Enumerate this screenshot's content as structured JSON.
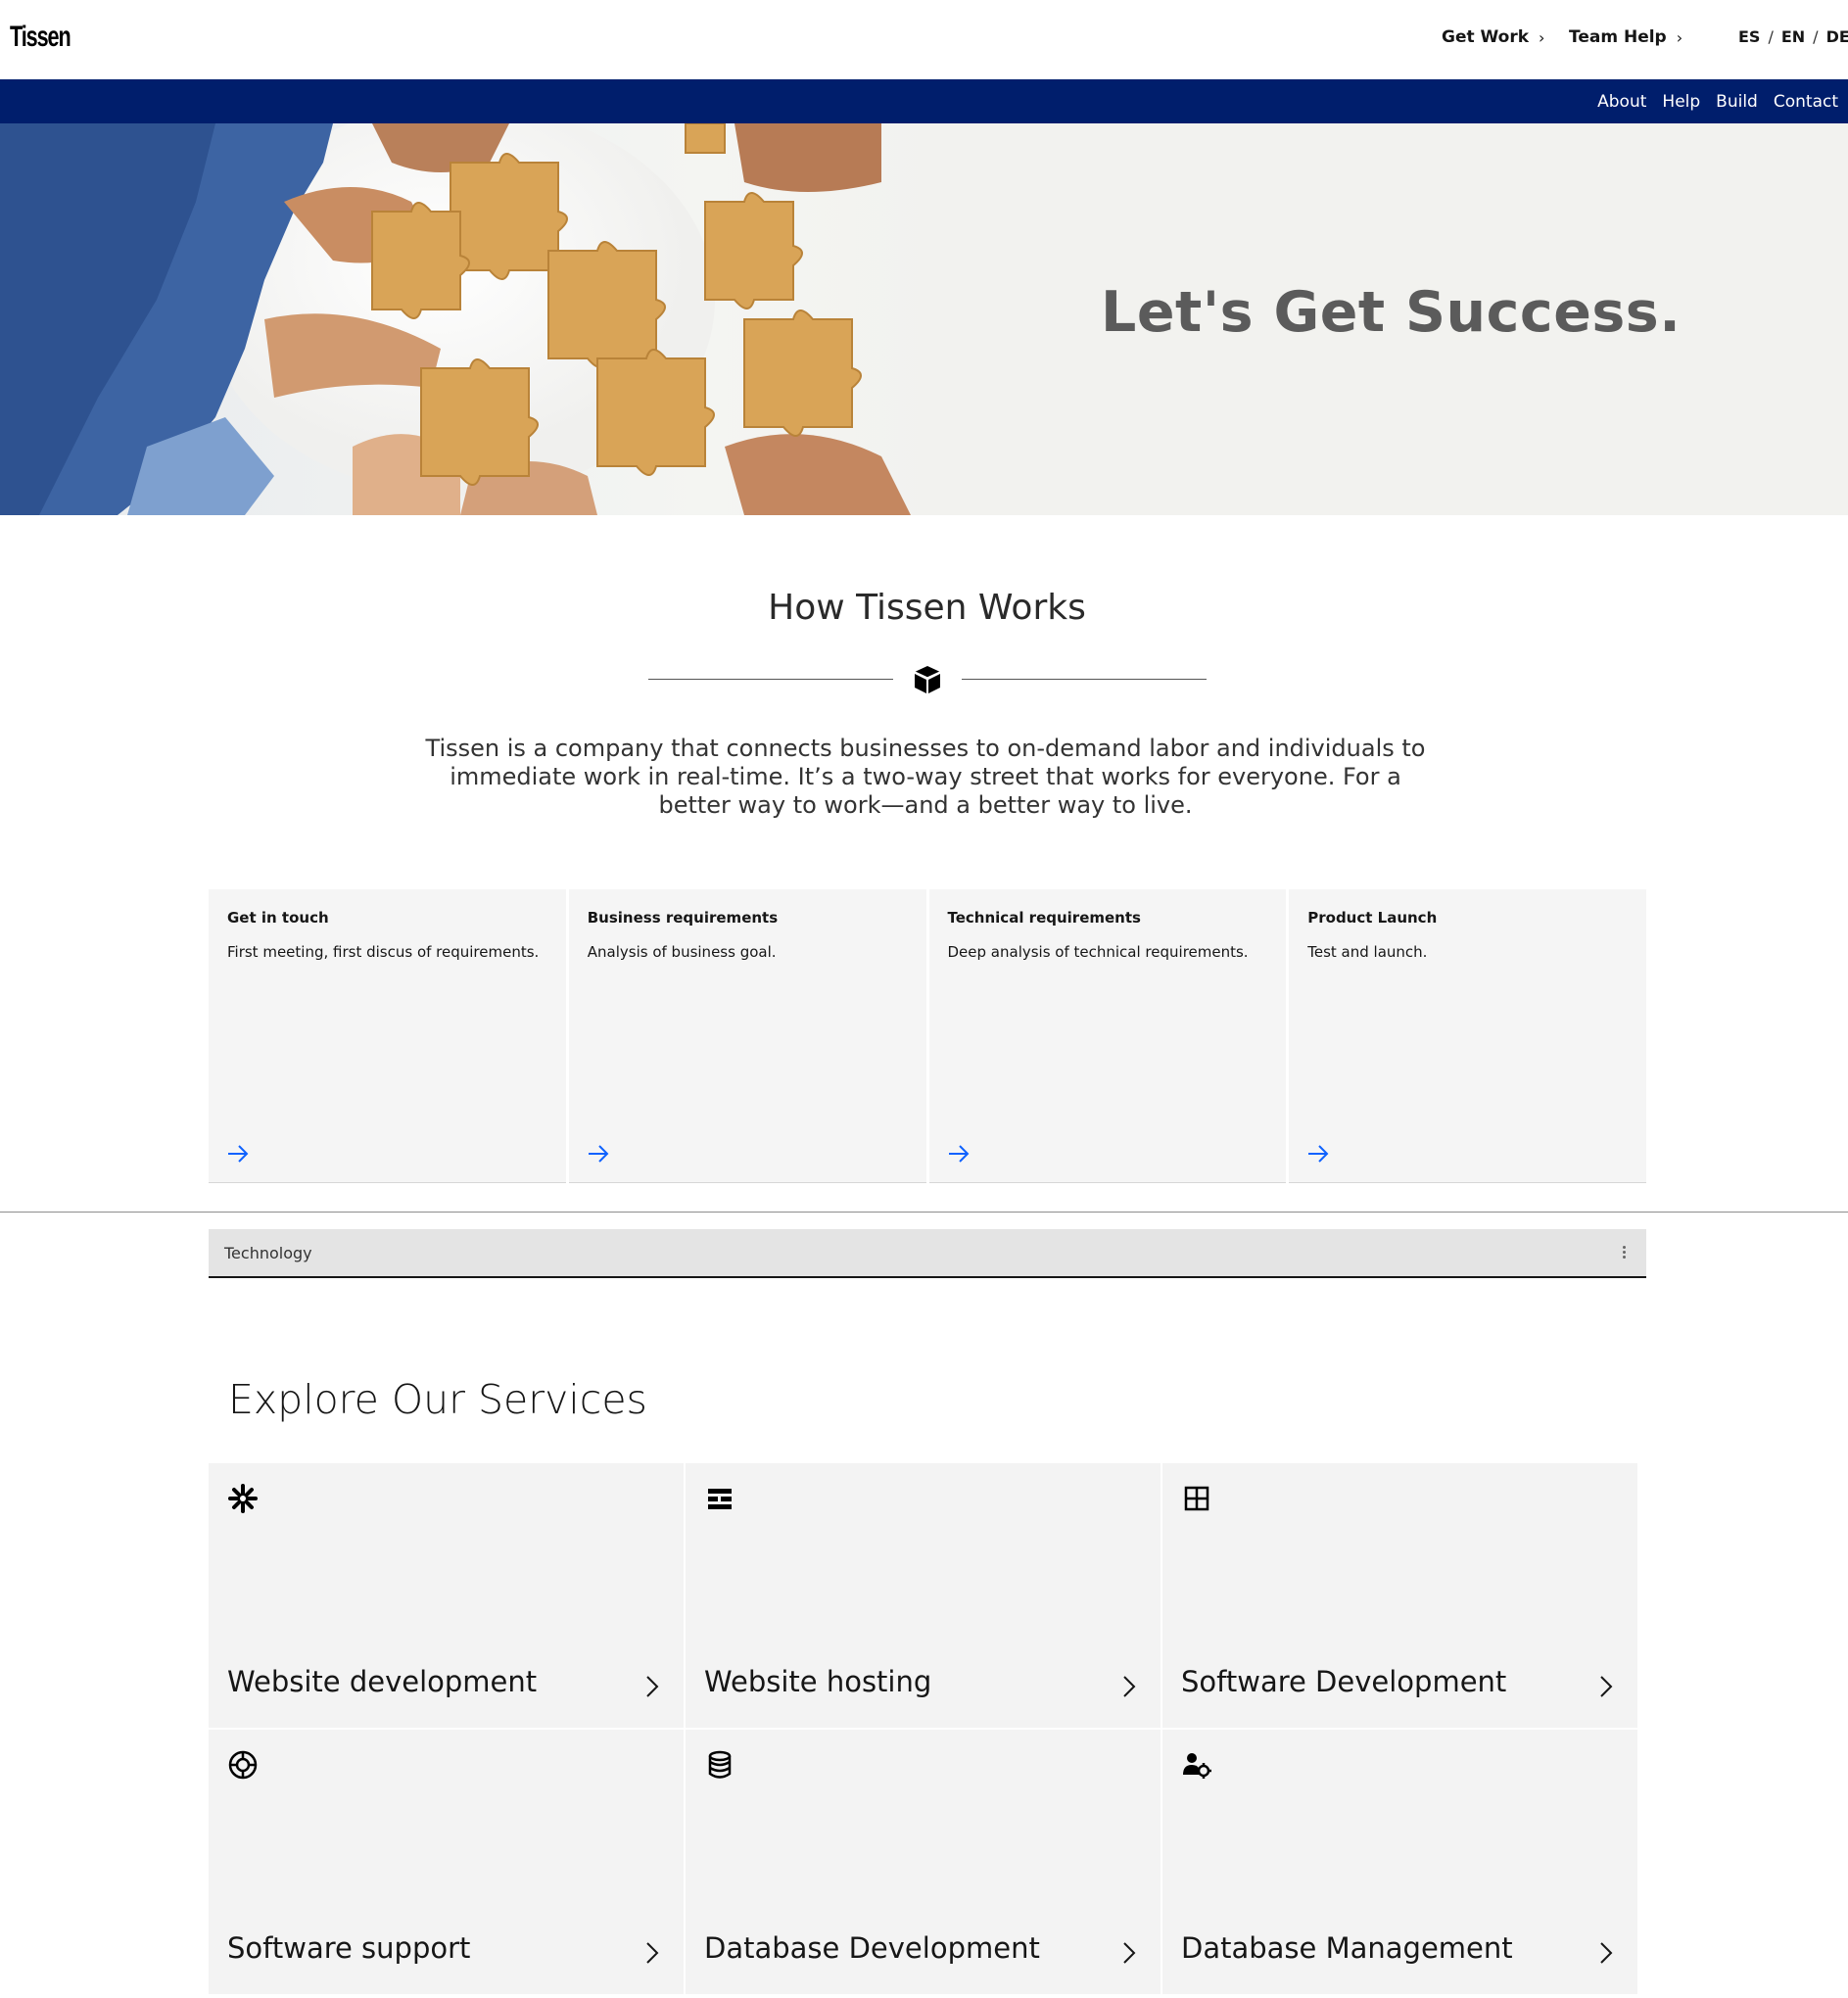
{
  "header": {
    "logo": "Tissen",
    "nav": [
      {
        "label": "Get Work"
      },
      {
        "label": "Team Help"
      }
    ],
    "languages": [
      "ES",
      "EN",
      "DE"
    ],
    "lang_separator": "/"
  },
  "subnav": [
    "About",
    "Help",
    "Build",
    "Contact"
  ],
  "hero": {
    "title": "Let's Get Success."
  },
  "how": {
    "title": "How Tissen Works",
    "description": "Tissen is a company that connects businesses to on-demand labor and individuals to immediate work in real-time. It’s a two-way street that works for everyone. For a better way to work—and a better way to live.",
    "steps": [
      {
        "title": "Get in touch",
        "text": "First meeting, first discus of requirements."
      },
      {
        "title": "Business requirements",
        "text": "Analysis of business goal."
      },
      {
        "title": "Technical requirements",
        "text": "Deep analysis of technical requirements."
      },
      {
        "title": "Product Launch",
        "text": "Test and launch."
      }
    ]
  },
  "tech_bar": {
    "label": "Technology"
  },
  "services": {
    "title": "Explore Our Services",
    "items": [
      {
        "name": "Website development",
        "icon": "asterisk-icon"
      },
      {
        "name": "Website hosting",
        "icon": "layout-blocks-icon"
      },
      {
        "name": "Software Development",
        "icon": "grid-icon"
      },
      {
        "name": "Software support",
        "icon": "lifebuoy-icon"
      },
      {
        "name": "Database Development",
        "icon": "database-icon"
      },
      {
        "name": "Database Management",
        "icon": "user-settings-icon"
      }
    ]
  },
  "colors": {
    "brand_bar": "#001e6c",
    "link_arrow": "#0f62fe",
    "hero_text": "#5b5b5b"
  }
}
